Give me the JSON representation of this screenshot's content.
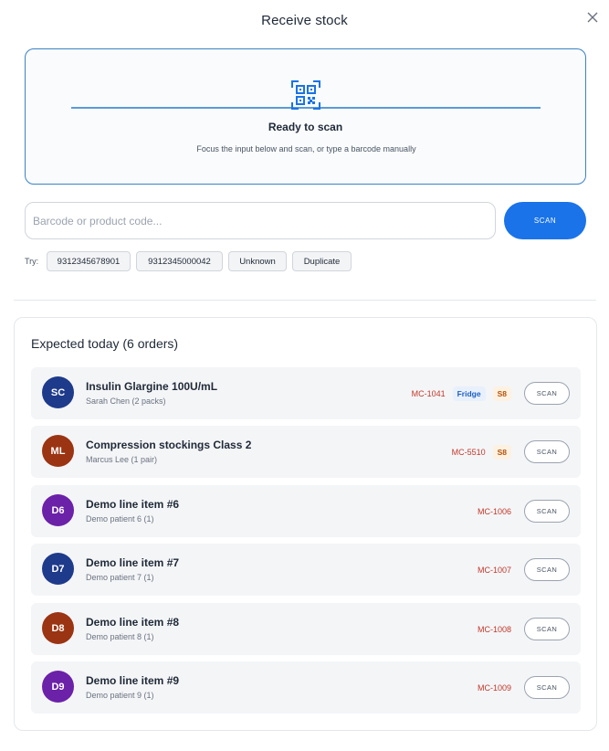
{
  "modal": {
    "title": "Receive stock"
  },
  "scanner": {
    "title": "Ready to scan",
    "subtitle": "Focus the input below and scan, or type a barcode manually"
  },
  "barcode": {
    "placeholder": "Barcode or product code...",
    "value": ""
  },
  "scan_button": {
    "label": "SCAN"
  },
  "try": {
    "label": "Try:",
    "chips": [
      "9312345678901",
      "9312345000042",
      "Unknown",
      "Duplicate"
    ]
  },
  "expected": {
    "title": "Expected today (6 orders)",
    "orders": [
      {
        "initials": "SC",
        "name": "Insulin Glargine 100U/mL",
        "patient": "Sarah Chen (2 packs)",
        "code": "MC-1041",
        "badges": [
          "Fridge",
          "S8"
        ],
        "scan_label": "SCAN",
        "avatar_color": "#1e3a8a"
      },
      {
        "initials": "ML",
        "name": "Compression stockings Class 2",
        "patient": "Marcus Lee (1 pair)",
        "code": "MC-5510",
        "badges": [
          "S8"
        ],
        "scan_label": "SCAN",
        "avatar_color": "#9a3412"
      },
      {
        "initials": "D6",
        "name": "Demo line item #6",
        "patient": "Demo patient 6 (1)",
        "code": "MC-1006",
        "badges": [],
        "scan_label": "SCAN",
        "avatar_color": "#6b21a8"
      },
      {
        "initials": "D7",
        "name": "Demo line item #7",
        "patient": "Demo patient 7 (1)",
        "code": "MC-1007",
        "badges": [],
        "scan_label": "SCAN",
        "avatar_color": "#1e3a8a"
      },
      {
        "initials": "D8",
        "name": "Demo line item #8",
        "patient": "Demo patient 8 (1)",
        "code": "MC-1008",
        "badges": [],
        "scan_label": "SCAN",
        "avatar_color": "#9a3412"
      },
      {
        "initials": "D9",
        "name": "Demo line item #9",
        "patient": "Demo patient 9 (1)",
        "code": "MC-1009",
        "badges": [],
        "scan_label": "SCAN",
        "avatar_color": "#6b21a8"
      }
    ]
  },
  "colors": {
    "accent": "#1a73e8",
    "order_code": "#c0392b",
    "scan_border": "#3b82c4"
  },
  "icons": {
    "close": "close-icon",
    "scanner": "qr-code-icon"
  }
}
